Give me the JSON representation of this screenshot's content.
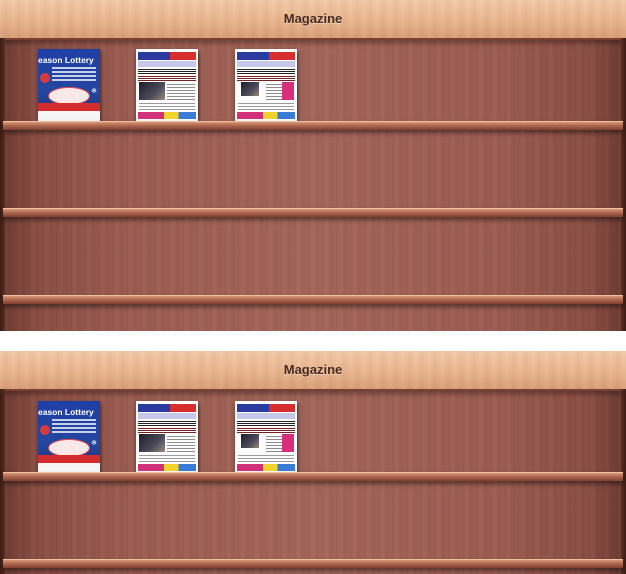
{
  "panels": [
    {
      "title": "Magazine"
    },
    {
      "title": "Magazine"
    }
  ],
  "publications": [
    {
      "cover_title": "eason Lottery",
      "type": "lottery-flyer"
    },
    {
      "cover_title": "",
      "type": "newspaper"
    },
    {
      "cover_title": "",
      "type": "newspaper"
    }
  ],
  "colors": {
    "wood_dark": "#6d3a30",
    "wood_mid": "#a4665a",
    "header_wood": "#e9b48d",
    "title_text": "#4a2a1e",
    "lottery_blue": "#24469f",
    "accent_red": "#d32d2d"
  }
}
